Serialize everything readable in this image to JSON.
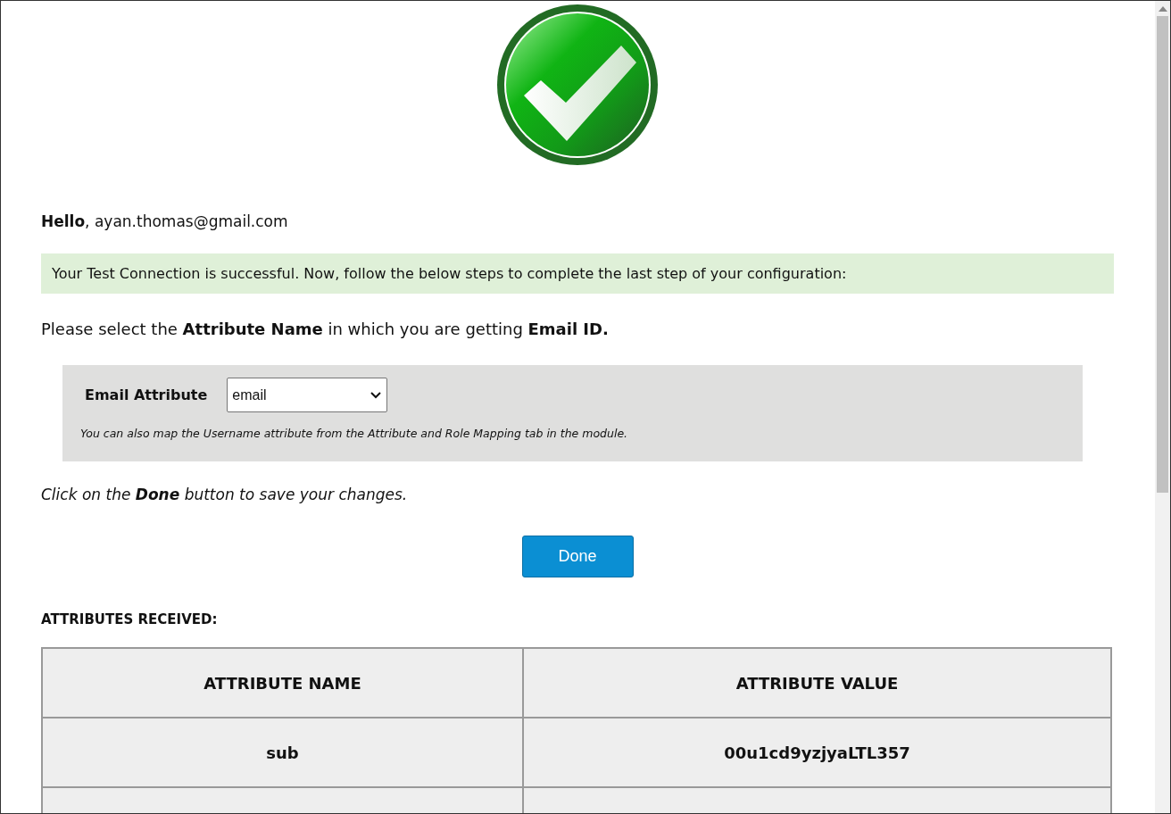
{
  "greeting": "**Hello**, ayan.thomas@gmail.com",
  "alert": "Your Test Connection is successful. Now, follow the below steps to complete the last step of your configuration:",
  "instruction": "Please select the **Attribute Name** in which you are getting **Email ID.**",
  "email_attribute": {
    "label": "Email Attribute",
    "value": "email",
    "note": "You can also map the Username attribute from the Attribute and Role Mapping tab in the module."
  },
  "save_hint": "Click on the **Done** button to save your changes.",
  "done_button": "Done",
  "attributes": {
    "heading": "ATTRIBUTES RECEIVED:",
    "columns": [
      "ATTRIBUTE NAME",
      "ATTRIBUTE VALUE"
    ],
    "rows": [
      [
        "sub",
        "00u1cd9yzjyaLTL357"
      ]
    ]
  }
}
